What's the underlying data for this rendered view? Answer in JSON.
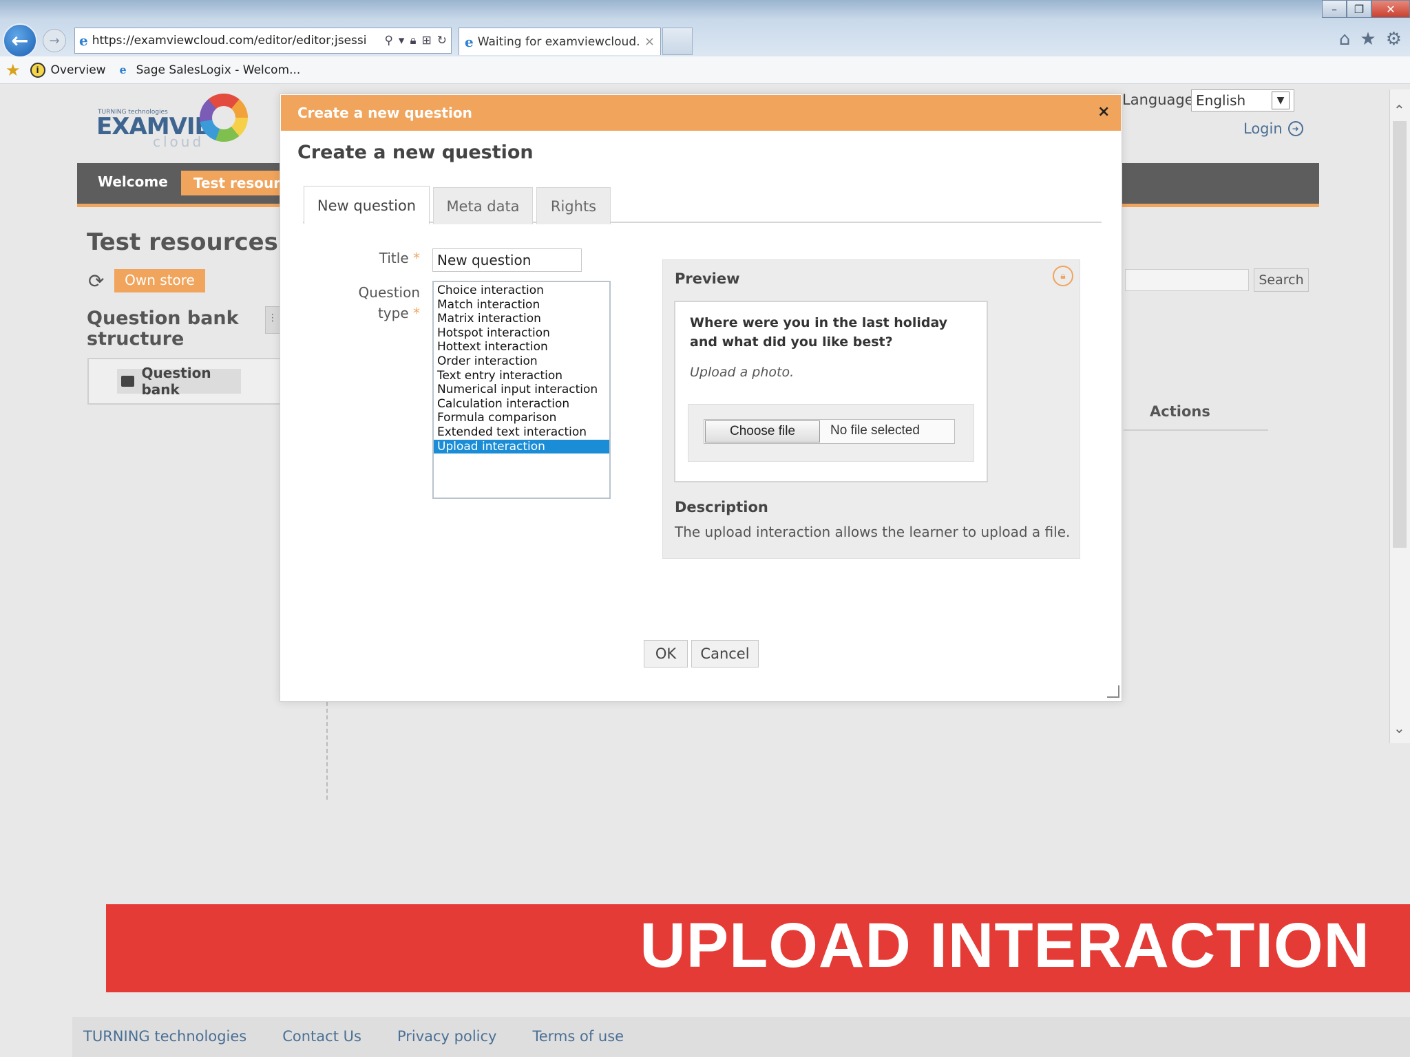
{
  "browser": {
    "address": "https://examviewcloud.com/editor/editor;jsessi",
    "tab_title": "Waiting for examviewcloud...",
    "tab_close": "×",
    "favorites": [
      "Overview",
      "Sage SalesLogix - Welcom..."
    ]
  },
  "site": {
    "logo_small": "TURNING technologies",
    "logo_big": "EXAMVIEW",
    "logo_sub": "cloud",
    "language_label": "Language",
    "language_value": "English",
    "login": "Login",
    "nav": {
      "welcome": "Welcome",
      "test_resources": "Test resources"
    },
    "test_resources_heading": "Test resources",
    "own_store": "Own store",
    "question_bank_structure": "Question bank structure",
    "question_bank": "Question bank",
    "search_button": "Search",
    "actions": "Actions"
  },
  "modal": {
    "titlebar": "Create a new question",
    "close": "×",
    "heading": "Create a new question",
    "tabs": [
      "New question",
      "Meta data",
      "Rights"
    ],
    "title_label": "Title",
    "title_value": "New question",
    "qtype_label": "Question type",
    "required_mark": "*",
    "question_types": [
      "Choice interaction",
      "Match interaction",
      "Matrix interaction",
      "Hotspot interaction",
      "Hottext interaction",
      "Order interaction",
      "Text entry interaction",
      "Numerical input interaction",
      "Calculation interaction",
      "Formula comparison",
      "Extended text interaction",
      "Upload interaction"
    ],
    "selected_type": "Upload interaction",
    "preview_label": "Preview",
    "preview_question": "Where were you in the last holiday and what did you like best?",
    "preview_prompt": "Upload a photo.",
    "choose_file": "Choose file",
    "no_file": "No file selected",
    "description_label": "Description",
    "description_text": "The upload interaction allows the learner to upload a file.",
    "ok": "OK",
    "cancel": "Cancel"
  },
  "banner": {
    "text": "UPLOAD INTERACTION"
  },
  "footer": {
    "links": [
      "TURNING technologies",
      "Contact Us",
      "Privacy policy",
      "Terms of use"
    ]
  },
  "colors": {
    "accent": "#f0a45c",
    "banner": "#e53b36",
    "link": "#4a6f95",
    "selection": "#1a8dd6"
  }
}
